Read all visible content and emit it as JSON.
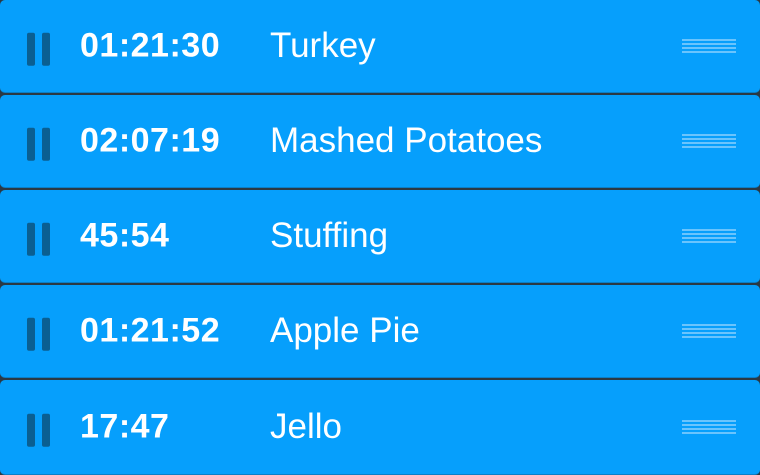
{
  "colors": {
    "row_background": "#069ffc",
    "pause_icon": "#0a5f92",
    "text": "#ffffff",
    "separator": "#2b3944"
  },
  "timers": [
    {
      "time": "01:21:30",
      "name": "Turkey",
      "pause_icon": "pause-icon",
      "handle_icon": "drag-handle-icon"
    },
    {
      "time": "02:07:19",
      "name": "Mashed Potatoes",
      "pause_icon": "pause-icon",
      "handle_icon": "drag-handle-icon"
    },
    {
      "time": "45:54",
      "name": "Stuffing",
      "pause_icon": "pause-icon",
      "handle_icon": "drag-handle-icon"
    },
    {
      "time": "01:21:52",
      "name": "Apple Pie",
      "pause_icon": "pause-icon",
      "handle_icon": "drag-handle-icon"
    },
    {
      "time": "17:47",
      "name": "Jello",
      "pause_icon": "pause-icon",
      "handle_icon": "drag-handle-icon"
    }
  ]
}
